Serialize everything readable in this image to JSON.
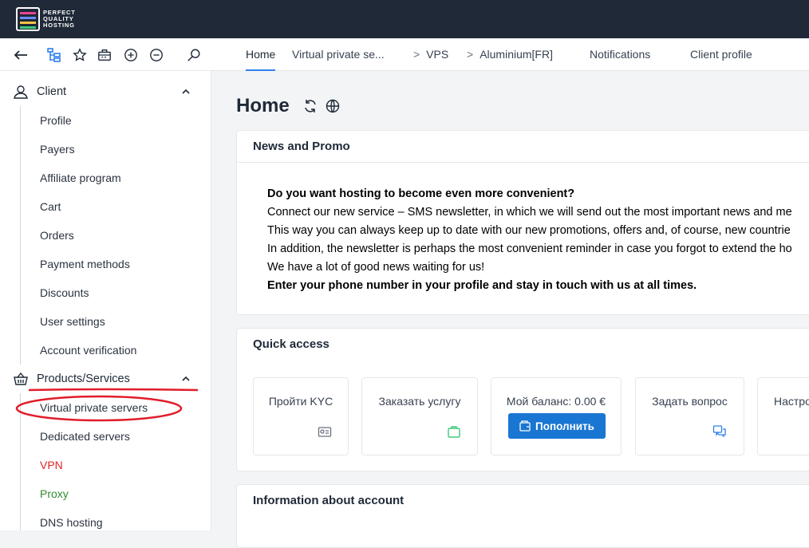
{
  "brand": {
    "logo_line1": "PERFECT",
    "logo_line2": "QUALITY",
    "logo_line3": "HOSTING"
  },
  "toolbar": {
    "icons": [
      "back-arrow-icon",
      "sitemap-icon",
      "star-icon",
      "briefcase-icon",
      "plus-circle-icon",
      "minus-circle-icon",
      "search-icon"
    ],
    "tabs": [
      {
        "label": "Home",
        "active": true
      },
      {
        "label": "Virtual private se...",
        "active": false
      },
      {
        "label": "VPS",
        "active": false
      },
      {
        "label": "Aluminium[FR]",
        "active": false
      },
      {
        "label": "Notifications",
        "active": false
      },
      {
        "label": "Client profile",
        "active": false
      }
    ]
  },
  "sidebar": {
    "client": {
      "label": "Client",
      "items": [
        "Profile",
        "Payers",
        "Affiliate program",
        "Cart",
        "Orders",
        "Payment methods",
        "Discounts",
        "User settings",
        "Account verification"
      ]
    },
    "products": {
      "label": "Products/Services",
      "items": [
        "Virtual private servers",
        "Dedicated servers",
        "VPN",
        "Proxy",
        "DNS hosting"
      ]
    }
  },
  "main": {
    "title": "Home",
    "news": {
      "heading": "News and Promo",
      "lines": [
        "Do you want hosting to become even more convenient?",
        "Connect our new service – SMS newsletter, in which we will send out the most important news and me",
        "This way you can always keep up to date with our new promotions, offers and, of course, new countrie",
        "In addition, the newsletter is perhaps the most convenient reminder in case you forgot to extend the ho",
        "We have a lot of good news waiting for us!",
        "Enter your phone number in your profile and stay in touch with us at all times."
      ]
    },
    "quick_access": {
      "heading": "Quick access",
      "tiles": [
        {
          "label": "Пройти KYC",
          "icon": "id-card-icon"
        },
        {
          "label": "Заказать услугу",
          "icon": "shopping-bag-icon"
        },
        {
          "label": "Мой баланс: 0.00 €",
          "button": "Пополнить",
          "icon": "wallet-icon"
        },
        {
          "label": "Задать вопрос",
          "icon": "chat-icon"
        },
        {
          "label": "Настро",
          "icon": "settings-icon"
        }
      ]
    },
    "account": {
      "heading": "Information about account"
    }
  },
  "colors": {
    "accent": "#2f80ed",
    "topbar": "#1f2937",
    "button": "#1976d2",
    "annotation": "#e11d2a"
  }
}
